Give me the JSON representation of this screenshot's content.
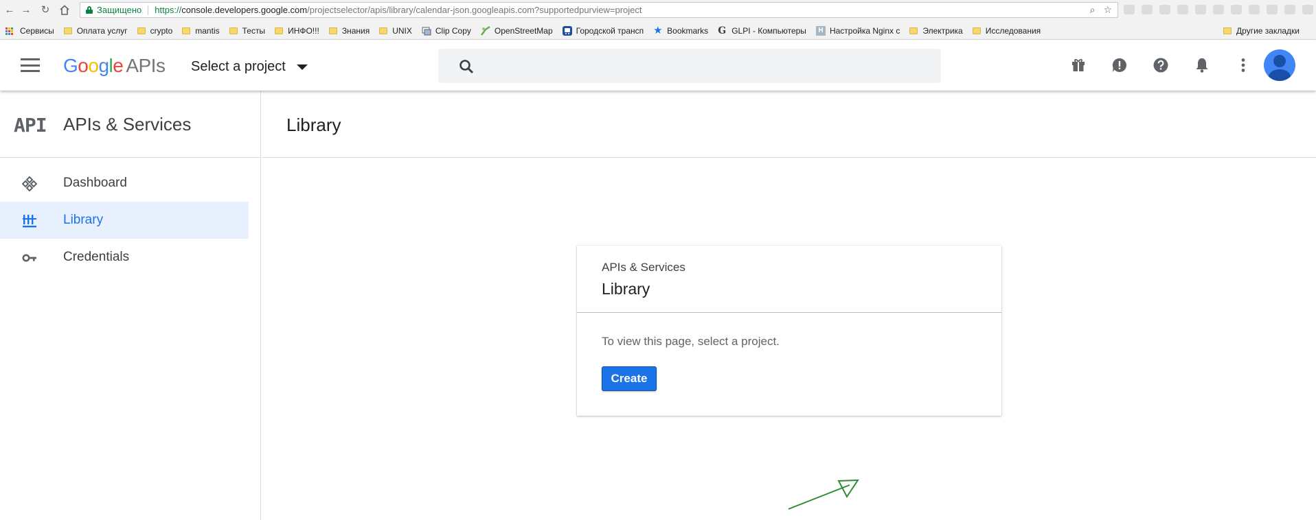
{
  "browser": {
    "secure_label": "Защищено",
    "url_scheme": "https://",
    "url_host": "console.developers.google.com",
    "url_path": "/projectselector/apis/library/calendar-json.googleapis.com?supportedpurview=project",
    "bookmarks": [
      {
        "label": "Сервисы",
        "icon": "apps-icon"
      },
      {
        "label": "Оплата услуг",
        "icon": "folder-icon"
      },
      {
        "label": "crypto",
        "icon": "folder-icon"
      },
      {
        "label": "mantis",
        "icon": "folder-icon"
      },
      {
        "label": "Тесты",
        "icon": "folder-icon"
      },
      {
        "label": "ИНФО!!!",
        "icon": "folder-icon"
      },
      {
        "label": "Знания",
        "icon": "folder-icon"
      },
      {
        "label": "UNIX",
        "icon": "folder-icon"
      },
      {
        "label": "Clip Copy",
        "icon": "clipboard-icon"
      },
      {
        "label": "OpenStreetMap",
        "icon": "map-icon"
      },
      {
        "label": "Городской трансп",
        "icon": "transport-icon"
      },
      {
        "label": "Bookmarks",
        "icon": "star-icon"
      },
      {
        "label": "GLPI - Компьютеры",
        "icon": "glpi-icon"
      },
      {
        "label": "Настройка Nginx с",
        "icon": "nginx-icon"
      },
      {
        "label": "Электрика",
        "icon": "folder-icon"
      },
      {
        "label": "Исследования",
        "icon": "folder-icon"
      }
    ],
    "other_bookmarks": "Другие закладки"
  },
  "header": {
    "logo_google": "Google",
    "logo_apis": "APIs",
    "project_selector": "Select a project",
    "search_placeholder": ""
  },
  "sidebar": {
    "badge": "API",
    "title": "APIs & Services",
    "items": [
      {
        "label": "Dashboard",
        "icon": "dashboard-icon",
        "active": false
      },
      {
        "label": "Library",
        "icon": "library-icon",
        "active": true
      },
      {
        "label": "Credentials",
        "icon": "key-icon",
        "active": false
      }
    ]
  },
  "main": {
    "title": "Library",
    "card": {
      "kicker": "APIs & Services",
      "title": "Library",
      "message": "To view this page, select a project.",
      "button": "Create"
    }
  },
  "colors": {
    "accent": "#1a73e8",
    "secure_green": "#0b8043",
    "annotation_arrow": "#2e8b2e"
  }
}
